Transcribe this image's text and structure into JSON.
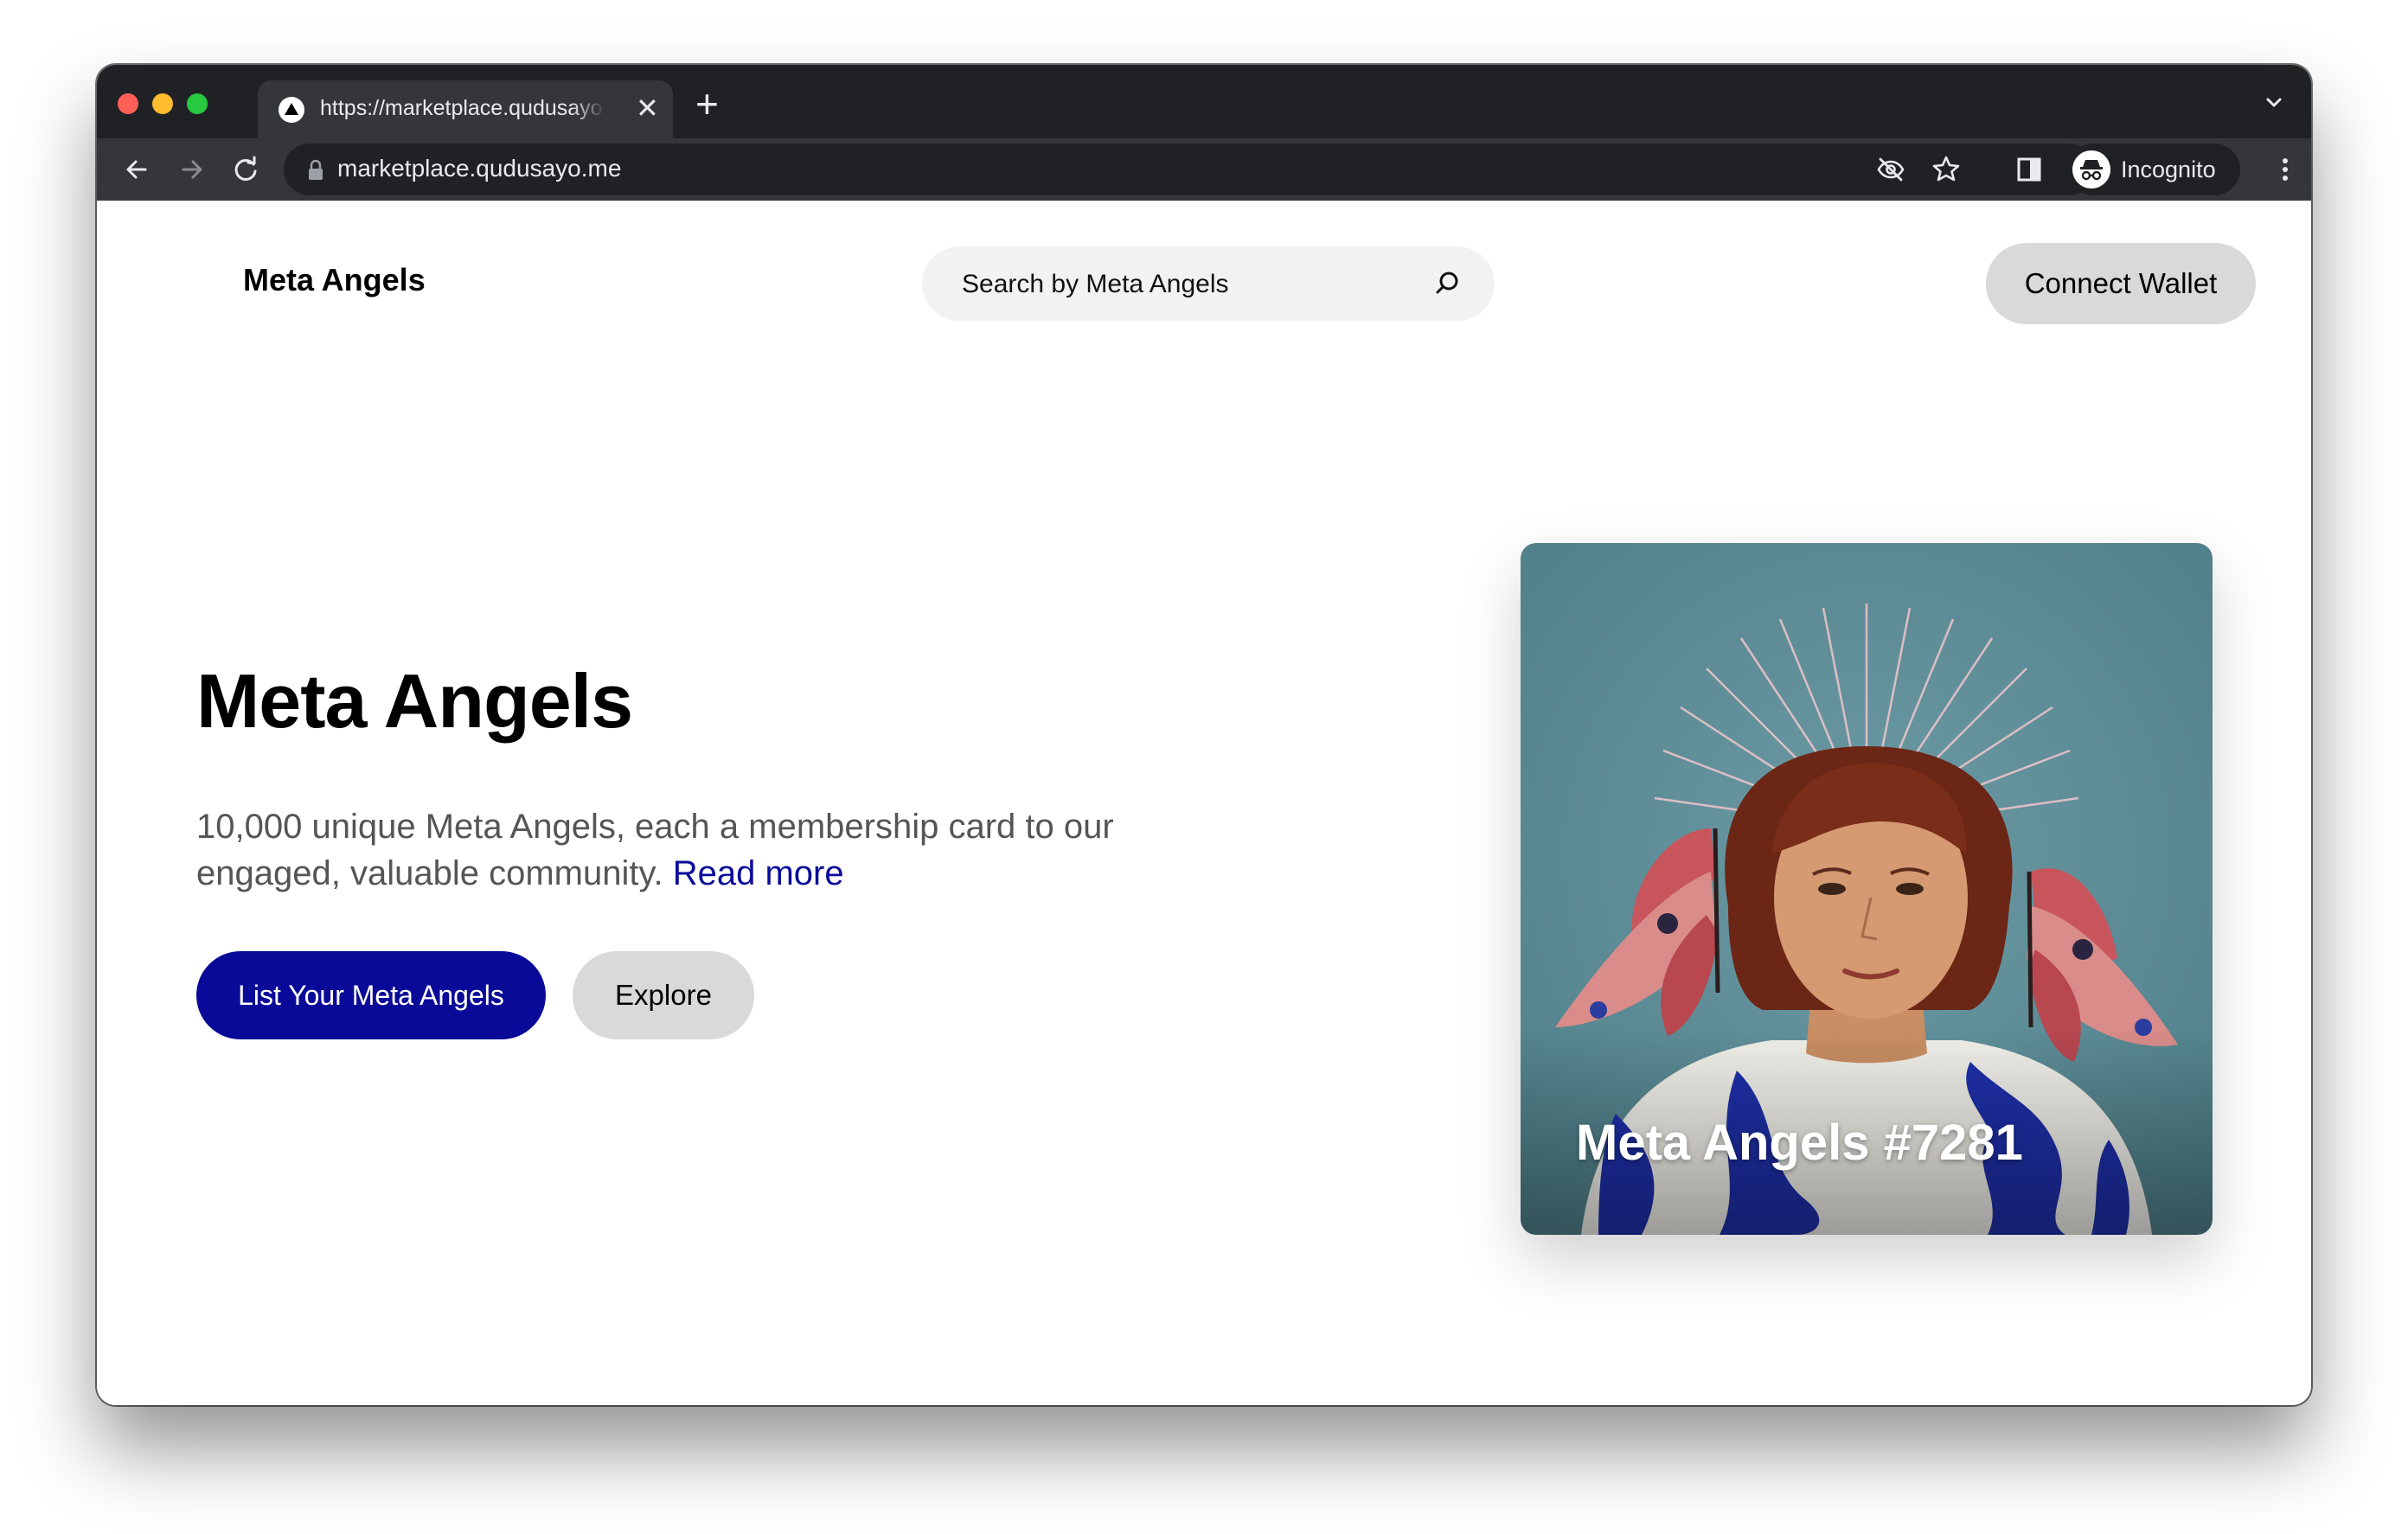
{
  "browser": {
    "tab_title": "https://marketplace.qudusayo.me",
    "tab_close": "✕",
    "new_tab": "+",
    "url": "marketplace.qudusayo.me",
    "profile_label": "Incognito"
  },
  "header": {
    "brand": "Meta Angels",
    "search_placeholder": "Search by Meta Angels",
    "connect_wallet": "Connect Wallet"
  },
  "hero": {
    "title": "Meta Angels",
    "description": "10,000 unique Meta Angels, each a membership card to our engaged, valuable community.",
    "read_more": "Read more",
    "primary_button": "List Your Meta Angels",
    "secondary_button": "Explore"
  },
  "featured": {
    "name": "Meta Angels #7281",
    "background_color": "#5e8e98",
    "accent_color": "#1e2fa8"
  },
  "colors": {
    "brand_blue": "#0a0a99",
    "link_blue": "#0b0b9a",
    "pill_gray": "#d9d9d9",
    "search_bg": "#f2f2f2",
    "chrome_dark": "#202124",
    "chrome_toolbar": "#35363a"
  },
  "icons": {
    "back": "arrow-left-icon",
    "forward": "arrow-right-icon",
    "reload": "reload-icon",
    "lock": "lock-icon",
    "eye_off": "eye-off-icon",
    "star": "star-icon",
    "sidebar": "side-panel-icon",
    "incognito": "incognito-icon",
    "menu": "kebab-menu-icon",
    "search": "search-icon",
    "tab_list": "chevron-down-icon"
  }
}
